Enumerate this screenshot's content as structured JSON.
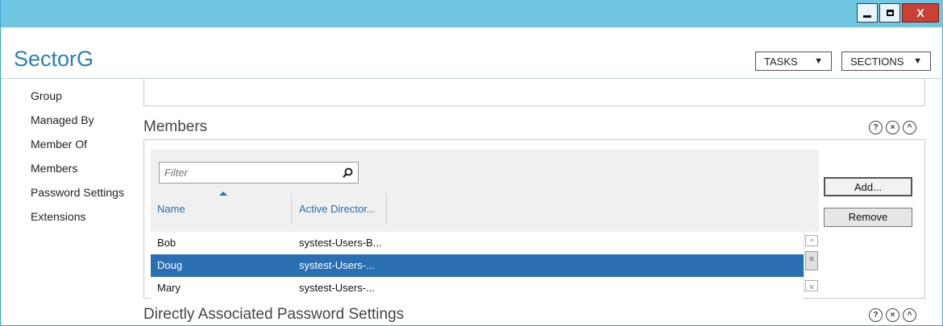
{
  "window": {
    "title": "",
    "controls": {
      "minimize": "minimize",
      "maximize": "maximize",
      "close_label": "X"
    }
  },
  "header": {
    "title": "SectorG",
    "tasks_label": "TASKS",
    "sections_label": "SECTIONS"
  },
  "nav": {
    "items": [
      {
        "label": "Group"
      },
      {
        "label": "Managed By"
      },
      {
        "label": "Member Of"
      },
      {
        "label": "Members"
      },
      {
        "label": "Password Settings"
      },
      {
        "label": "Extensions"
      }
    ]
  },
  "members": {
    "title": "Members",
    "filter_placeholder": "Filter",
    "columns": [
      "Name",
      "Active Director..."
    ],
    "sort_column": "Name",
    "rows": [
      {
        "name": "Bob",
        "ad": "systest-Users-B...",
        "selected": false
      },
      {
        "name": "Doug",
        "ad": "systest-Users-...",
        "selected": true
      },
      {
        "name": "Mary",
        "ad": "systest-Users-...",
        "selected": false
      }
    ],
    "add_label": "Add...",
    "remove_label": "Remove"
  },
  "password_section": {
    "title": "Directly Associated Password Settings"
  },
  "section_icons": {
    "help": "?",
    "close": "×",
    "collapse": "^"
  },
  "colors": {
    "titlebar": "#6fc6e3",
    "accent": "#2b7fb5",
    "selection": "#2a6fb2",
    "close": "#c74135"
  }
}
